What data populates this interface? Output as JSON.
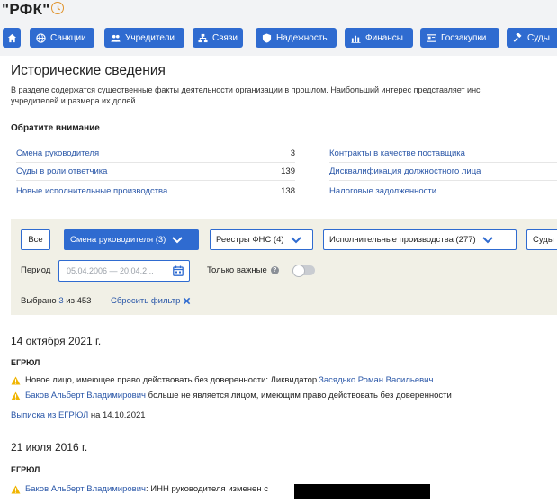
{
  "header": {
    "company": "\"РФК\"",
    "history_icon": "clock-icon",
    "accent": "#2f6bd0"
  },
  "nav": [
    {
      "id": "home",
      "label": "",
      "icon": "home-icon"
    },
    {
      "id": "sanctions",
      "label": "Санкции",
      "icon": "globe-icon"
    },
    {
      "id": "founders",
      "label": "Учредители",
      "icon": "people-icon"
    },
    {
      "id": "links",
      "label": "Связи",
      "icon": "network-icon"
    },
    {
      "id": "reliability",
      "label": "Надежность",
      "icon": "shield-icon"
    },
    {
      "id": "finance",
      "label": "Финансы",
      "icon": "chart-icon"
    },
    {
      "id": "procurement",
      "label": "Госзакупки",
      "icon": "card-icon"
    },
    {
      "id": "courts",
      "label": "Суды",
      "icon": "hammer-icon"
    }
  ],
  "page": {
    "title": "Исторические сведения",
    "intro_line1": "В разделе содержатся существенные факты деятельности организации в прошлом. Наибольший интерес представляет инс",
    "intro_line2": "учредителей и размера их долей.",
    "notice_title": "Обратите внимание"
  },
  "facts_left": [
    {
      "label": "Смена руководителя",
      "count": "3"
    },
    {
      "label": "Суды в роли ответчика",
      "count": "139"
    },
    {
      "label": "Новые исполнительные производства",
      "count": "138"
    }
  ],
  "facts_right": [
    {
      "label": "Контракты в качестве поставщика"
    },
    {
      "label": "Дисквалификация должностного лица"
    },
    {
      "label": "Налоговые задолженности"
    }
  ],
  "filters": {
    "all": "Все",
    "chips": [
      {
        "label": "Смена руководителя (3)",
        "active": true
      },
      {
        "label": "Реестры ФНС (4)",
        "active": false
      },
      {
        "label": "Исполнительные производства (277)",
        "active": false
      },
      {
        "label": "Суды",
        "active": false
      }
    ],
    "period_label": "Период",
    "period_placeholder": "05.04.2006 — 20.04.2...",
    "important_label": "Только важные",
    "important_on": false,
    "selected_prefix": "Выбрано",
    "selected_count": "3",
    "selected_suffix": "из 453",
    "reset": "Сбросить фильтр"
  },
  "events": [
    {
      "date": "14 октября 2021 г.",
      "source": "ЕГРЮЛ",
      "items": [
        {
          "text": "Новое лицо, имеющее право действовать без доверенности: Ликвидатор ",
          "link": "Засядько Роман Васильевич"
        },
        {
          "link": "Баков Альберт Владимирович",
          "text": " больше не является лицом, имеющим право действовать без доверенности"
        }
      ],
      "extract_link": "Выписка из ЕГРЮЛ",
      "extract_date": " на 14.10.2021"
    },
    {
      "date": "21 июля 2016 г.",
      "source": "ЕГРЮЛ",
      "items": [
        {
          "link": "Баков Альберт Владимирович",
          "text": ": ИНН руководителя изменен с "
        }
      ]
    }
  ]
}
